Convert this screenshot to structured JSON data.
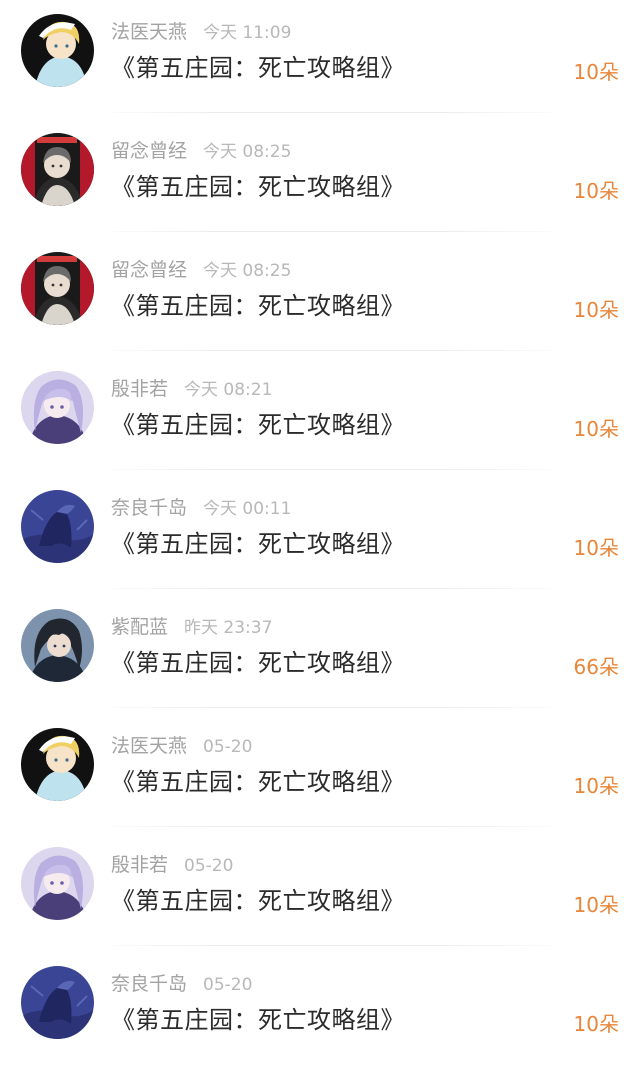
{
  "feed": {
    "items": [
      {
        "name": "法医天燕",
        "time": "今天 11:09",
        "title": "《第五庄园：死亡攻略组》",
        "count": "10朵",
        "avatar": "avatar-blonde-icon"
      },
      {
        "name": "留念曾经",
        "time": "今天 08:25",
        "title": "《第五庄园：死亡攻略组》",
        "count": "10朵",
        "avatar": "avatar-red-banner-icon"
      },
      {
        "name": "留念曾经",
        "time": "今天 08:25",
        "title": "《第五庄园：死亡攻略组》",
        "count": "10朵",
        "avatar": "avatar-red-banner-icon"
      },
      {
        "name": "殷非若",
        "time": "今天 08:21",
        "title": "《第五庄园：死亡攻略组》",
        "count": "10朵",
        "avatar": "avatar-purple-hair-icon"
      },
      {
        "name": "奈良千岛",
        "time": "今天 00:11",
        "title": "《第五庄园：死亡攻略组》",
        "count": "10朵",
        "avatar": "avatar-blue-figure-icon"
      },
      {
        "name": "紫配蓝",
        "time": "昨天 23:37",
        "title": "《第五庄园：死亡攻略组》",
        "count": "66朵",
        "avatar": "avatar-dark-hair-icon"
      },
      {
        "name": "法医天燕",
        "time": "05-20",
        "title": "《第五庄园：死亡攻略组》",
        "count": "10朵",
        "avatar": "avatar-blonde-icon"
      },
      {
        "name": "殷非若",
        "time": "05-20",
        "title": "《第五庄园：死亡攻略组》",
        "count": "10朵",
        "avatar": "avatar-purple-hair-icon"
      },
      {
        "name": "奈良千岛",
        "time": "05-20",
        "title": "《第五庄园：死亡攻略组》",
        "count": "10朵",
        "avatar": "avatar-blue-figure-icon"
      }
    ]
  },
  "colors": {
    "name": "#a3a3a3",
    "time": "#b8b8b8",
    "title": "#2b2b2b",
    "count": "#e8863a"
  }
}
